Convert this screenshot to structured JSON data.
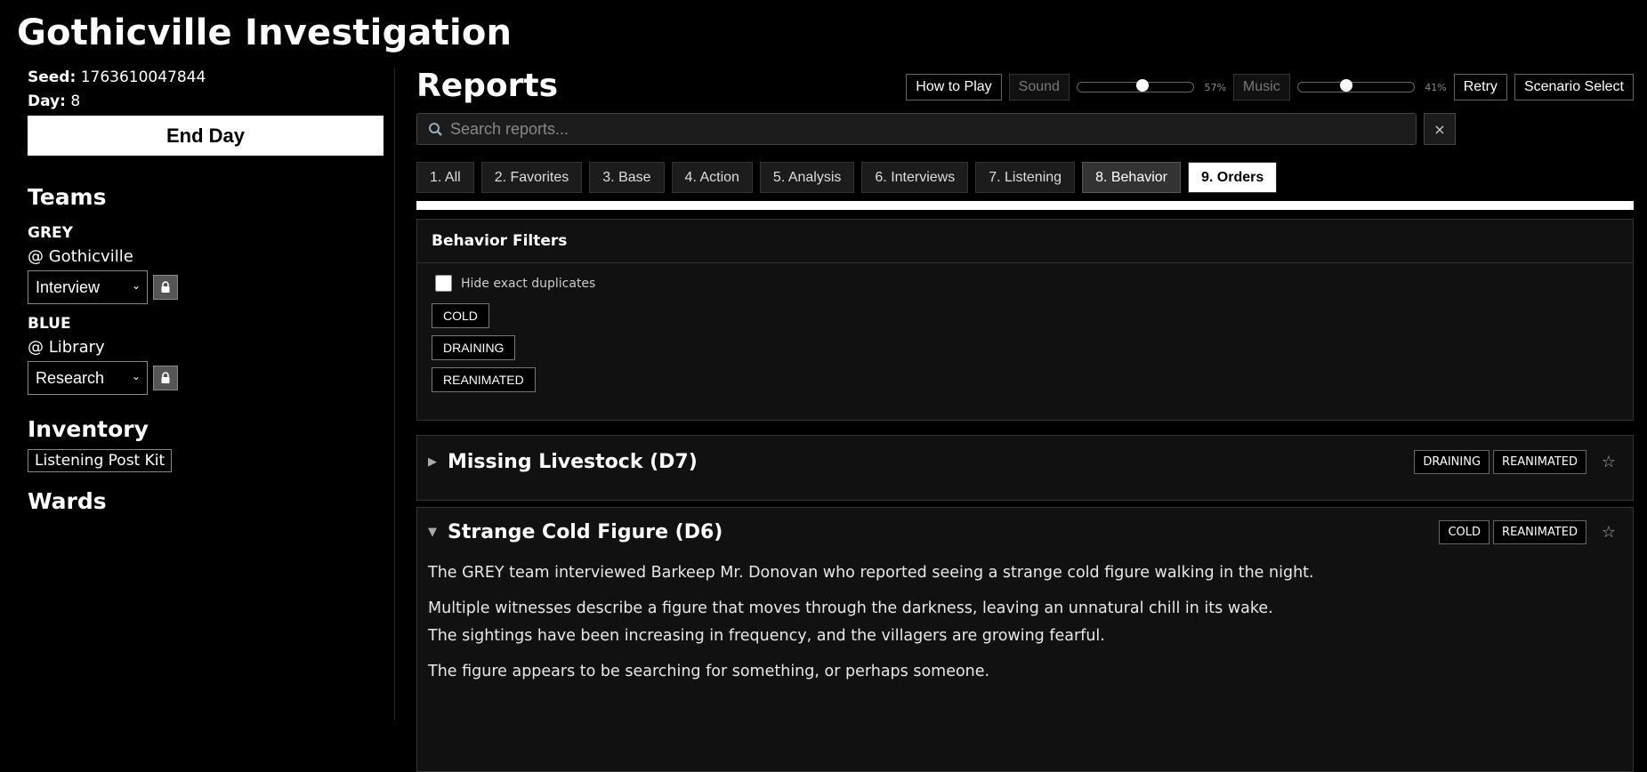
{
  "app_title": "Gothicville Investigation",
  "sidebar": {
    "seed_label": "Seed:",
    "seed_value": "1763610047844",
    "day_label": "Day:",
    "day_value": "8",
    "end_day_label": "End Day",
    "teams_heading": "Teams",
    "teams": [
      {
        "name": "GREY",
        "location": "@ Gothicville",
        "task": "Interview"
      },
      {
        "name": "BLUE",
        "location": "@ Library",
        "task": "Research"
      }
    ],
    "inventory_heading": "Inventory",
    "inventory_items": [
      "Listening Post Kit"
    ],
    "wards_heading": "Wards"
  },
  "main": {
    "title": "Reports",
    "controls": {
      "how_to_play": "How to Play",
      "sound_label": "Sound",
      "sound_level": 0.57,
      "sound_pct": "57%",
      "music_label": "Music",
      "music_level": 0.41,
      "music_pct": "41%",
      "retry": "Retry",
      "scenario_select": "Scenario Select"
    },
    "search": {
      "placeholder": "Search reports...",
      "icon": "magnifier-icon",
      "clear": "×"
    },
    "tabs": [
      {
        "label": "1. All"
      },
      {
        "label": "2. Favorites"
      },
      {
        "label": "3. Base"
      },
      {
        "label": "4. Action"
      },
      {
        "label": "5. Analysis"
      },
      {
        "label": "6. Interviews"
      },
      {
        "label": "7. Listening"
      },
      {
        "label": "8. Behavior"
      },
      {
        "label": "9. Orders"
      }
    ],
    "active_tab": "9. Orders",
    "filters": {
      "heading": "Behavior Filters",
      "hide_duplicates_label": "Hide exact duplicates",
      "hide_duplicates_checked": false,
      "tags": [
        "COLD",
        "DRAINING",
        "REANIMATED"
      ]
    },
    "reports": [
      {
        "title": "Missing Livestock (D7)",
        "expanded": false,
        "tags": [
          "DRAINING",
          "REANIMATED"
        ],
        "favorite_icon": "☆"
      },
      {
        "title": "Strange Cold Figure (D6)",
        "expanded": true,
        "tags": [
          "COLD",
          "REANIMATED"
        ],
        "favorite_icon": "☆",
        "paragraphs": [
          "The GREY team interviewed Barkeep Mr. Donovan who reported seeing a strange cold figure walking in the night.",
          "Multiple witnesses describe a figure that moves through the darkness, leaving an unnatural chill in its wake.",
          "The sightings have been increasing in frequency, and the villagers are growing fearful.",
          "The figure appears to be searching for something, or perhaps someone."
        ]
      }
    ]
  }
}
